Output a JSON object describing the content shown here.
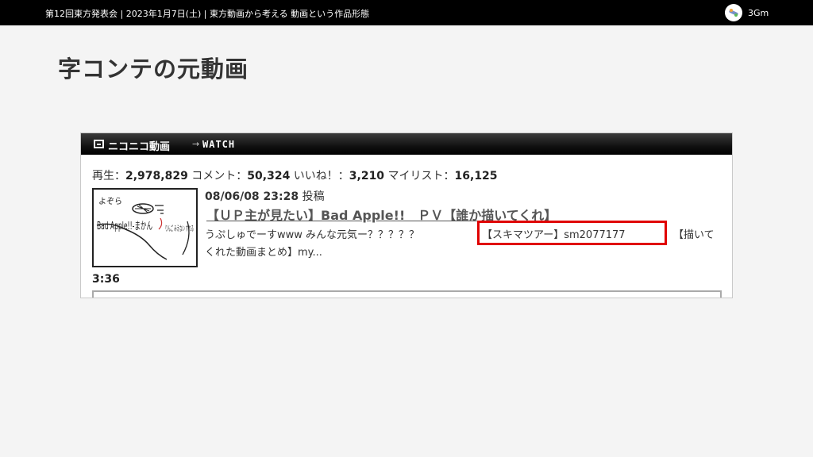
{
  "topbar": {
    "title": "第12回東方発表会 | 2023年1月7日(土) | 東方動画から考える 動画という作品形態",
    "brand": "3Gm"
  },
  "heading": "字コンテの元動画",
  "site": {
    "logo_text": "ニコニコ動画",
    "arrow": "→",
    "section": "WATCH"
  },
  "stats": {
    "views_label": "再生：",
    "views": "2,978,829",
    "comments_label": "コメント：",
    "comments": "50,324",
    "likes_label": "いいね！：",
    "likes": "3,210",
    "mylist_label": "マイリスト：",
    "mylist": "16,125"
  },
  "video": {
    "post_date": "08/06/08 23:28",
    "post_label": "投稿",
    "title": "【ＵＰ主が見たい】Bad Apple!!　ＰＶ【誰か描いてくれ】",
    "desc_line1": "うぷしゅでーすwww みんな元気ー？？？？？",
    "desc_link": "【スキマツアー】sm2077177",
    "desc_tail": "【描いて",
    "desc_line2": "くれた動画まとめ】my...",
    "duration": "3:36",
    "thumbnail_text": {
      "top": "よぞら",
      "left": "Bad Apple!!-まかん",
      "right": "りんご みえない すれる"
    }
  }
}
